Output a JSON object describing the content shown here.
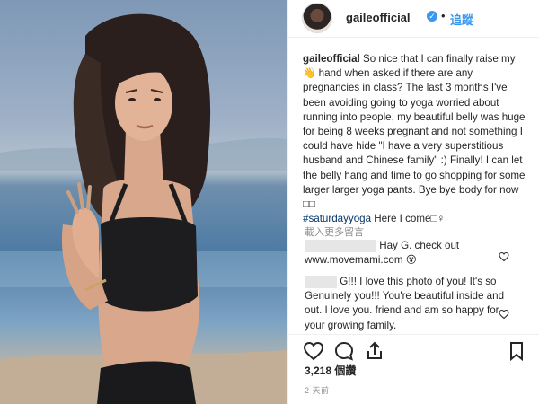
{
  "post": {
    "image_alt": "Woman with hands in prayer pose on a beach",
    "username": "gaileofficial",
    "follow_label": "追蹤",
    "dot": "•",
    "caption_user": "gaileofficial",
    "caption_text_1": " So nice that I can finally raise my ",
    "caption_emoji": "👋",
    "caption_text_2": " hand when asked if there are any pregnancies in class? The last 3 months I've been avoiding going to yoga worried about running into people, my beautiful belly was huge for being 8 weeks pregnant and not something I could have hide \"I have a very superstitious husband and Chinese family\" :) Finally! I can let the belly hang and time to go shopping for some larger larger yoga pants. Bye bye body for now ",
    "caption_boxes": "□□",
    "caption_hashtag": "#saturdayyoga",
    "caption_text_3": " Here I come",
    "caption_end": "□♀",
    "load_more": "載入更多留言",
    "comments": [
      {
        "text": "Hay G. check out www.movemami.com 😮"
      },
      {
        "text": "G!!! I love this photo of you! It's so Genuinely you!!! You're beautiful inside and out. I love you. friend and am so happy for your growing family."
      }
    ],
    "likes": "3,218 個讚",
    "time": "2 天前"
  },
  "colors": {
    "accent": "#3897f0",
    "text": "#262626",
    "muted": "#8e8e8e"
  },
  "icons": {
    "verified": "verified-check-icon",
    "like": "heart-icon",
    "comment": "comment-bubble-icon",
    "share": "share-icon",
    "save": "bookmark-icon"
  }
}
